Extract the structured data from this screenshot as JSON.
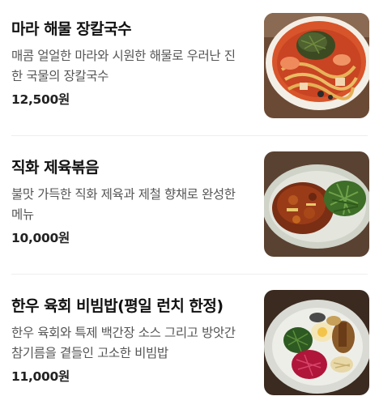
{
  "menu": {
    "items": [
      {
        "name": "마라 해물 장칼국수",
        "description": "매콤 얼얼한 마라와 시원한 해물로 우러난 진한 국물의 장칼국수",
        "price": "12,500원",
        "image_icon": "mala-seafood-noodle-photo"
      },
      {
        "name": "직화 제육볶음",
        "description": "불맛 가득한 직화 제육과 제철 향채로 완성한 메뉴",
        "price": "10,000원",
        "image_icon": "stir-fried-pork-photo"
      },
      {
        "name": "한우 육회 비빔밥(평일 런치 한정)",
        "description": "한우 육회와 특제 백간장 소스 그리고 방앗간 참기름을 곁들인 고소한 비빔밥",
        "price": "11,000원",
        "image_icon": "beef-tartare-bibimbap-photo"
      }
    ]
  }
}
